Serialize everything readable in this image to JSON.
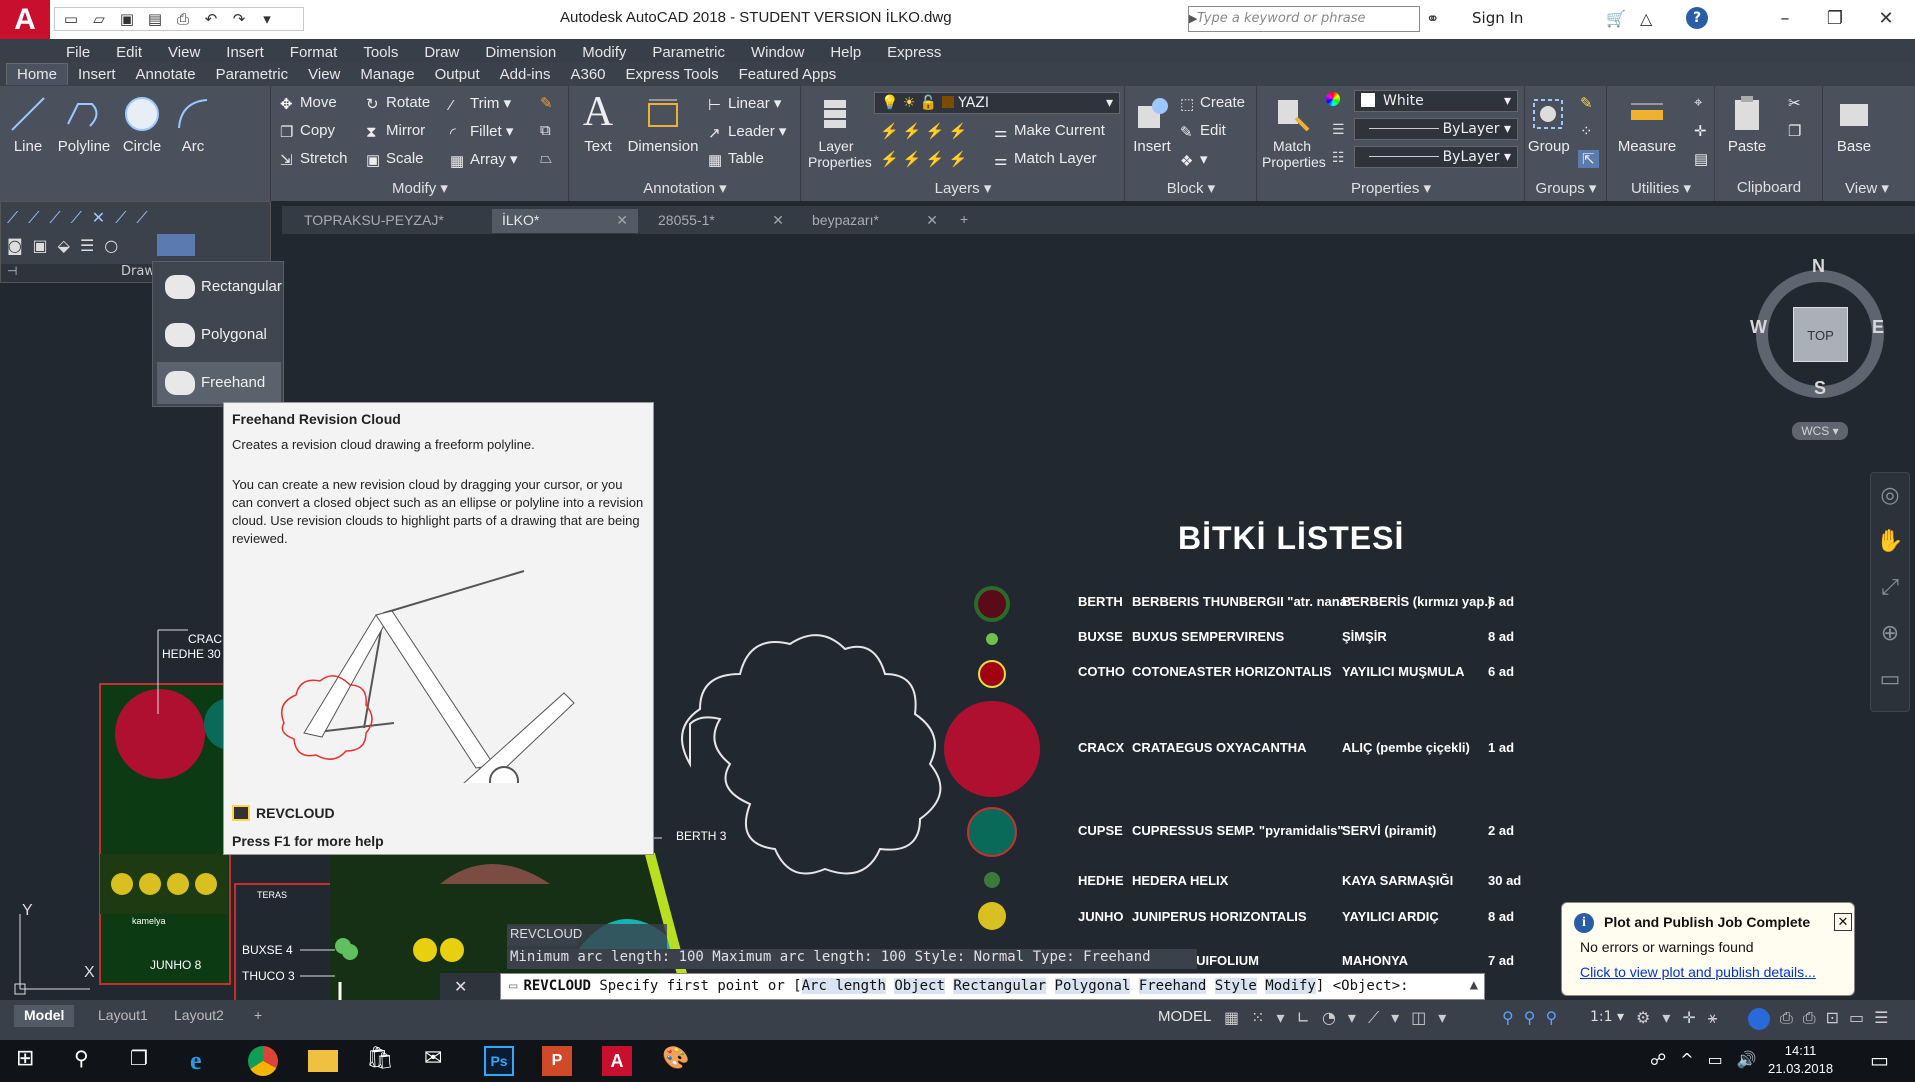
{
  "window": {
    "title": "Autodesk AutoCAD 2018 - STUDENT VERSION    İLKO.dwg",
    "search_placeholder": "Type a keyword or phrase",
    "signin": "Sign In"
  },
  "menubar": [
    "File",
    "Edit",
    "View",
    "Insert",
    "Format",
    "Tools",
    "Draw",
    "Dimension",
    "Modify",
    "Parametric",
    "Window",
    "Help",
    "Express"
  ],
  "ribbon_tabs": [
    "Home",
    "Insert",
    "Annotate",
    "Parametric",
    "View",
    "Manage",
    "Output",
    "Add-ins",
    "A360",
    "Express Tools",
    "Featured Apps"
  ],
  "ribbon": {
    "draw": {
      "line": "Line",
      "polyline": "Polyline",
      "circle": "Circle",
      "arc": "Arc"
    },
    "modify": {
      "label": "Modify",
      "move": "Move",
      "rotate": "Rotate",
      "trim": "Trim",
      "copy": "Copy",
      "mirror": "Mirror",
      "fillet": "Fillet",
      "stretch": "Stretch",
      "scale": "Scale",
      "array": "Array"
    },
    "annotation": {
      "label": "Annotation",
      "text": "Text",
      "dimension": "Dimension",
      "linear": "Linear",
      "leader": "Leader",
      "table": "Table"
    },
    "layers": {
      "label": "Layers",
      "layer_properties": "Layer Properties",
      "current_layer": "YAZI",
      "make_current": "Make Current",
      "match_layer": "Match Layer"
    },
    "block": {
      "label": "Block",
      "insert": "Insert",
      "create": "Create",
      "edit": "Edit"
    },
    "properties": {
      "label": "Properties",
      "match": "Match Properties",
      "color": "White",
      "linetype": "ByLayer",
      "lineweight": "ByLayer"
    },
    "groups": {
      "label": "Groups",
      "group": "Group"
    },
    "utilities": {
      "label": "Utilities",
      "measure": "Measure"
    },
    "clipboard": {
      "label": "Clipboard",
      "paste": "Paste"
    },
    "view": {
      "label": "View",
      "base": "Base"
    }
  },
  "draw_toolbar": {
    "label": "Draw"
  },
  "file_tabs": [
    "TOPRAKSU-PEYZAJ*",
    "İLKO*",
    "28055-1*",
    "beypazarı*"
  ],
  "revcloud_menu": [
    "Rectangular",
    "Polygonal",
    "Freehand"
  ],
  "tooltip": {
    "title": "Freehand Revision Cloud",
    "desc1": "Creates a revision cloud drawing a freeform polyline.",
    "desc2": "You can create a new revision cloud by dragging your cursor, or you can convert a closed object such as an ellipse or polyline into a revision cloud. Use revision clouds to highlight parts of a drawing that are being reviewed.",
    "command": "REVCLOUD",
    "help": "Press F1 for more help"
  },
  "plant_list": {
    "title": "BİTKİ LİSTESİ",
    "rows": [
      {
        "code": "BERTH",
        "latin": "BERBERIS THUNBERGII \"atr. nana\"",
        "local": "BERBERİS (kırmızı yap.)",
        "qty": "6 ad"
      },
      {
        "code": "BUXSE",
        "latin": "BUXUS SEMPERVIRENS",
        "local": "ŞİMŞİR",
        "qty": "8 ad"
      },
      {
        "code": "COTHO",
        "latin": "COTONEASTER HORIZONTALIS",
        "local": "YAYILICI MUŞMULA",
        "qty": "6 ad"
      },
      {
        "code": "CRACX",
        "latin": "CRATAEGUS OXYACANTHA",
        "local": "ALIÇ (pembe çiçekli)",
        "qty": "1 ad"
      },
      {
        "code": "CUPSE",
        "latin": "CUPRESSUS SEMP. \"pyramidalis\"",
        "local": "SERVİ (piramit)",
        "qty": "2 ad"
      },
      {
        "code": "HEDHE",
        "latin": "HEDERA HELIX",
        "local": "KAYA SARMAŞIĞI",
        "qty": "30 ad"
      },
      {
        "code": "JUNHO",
        "latin": "JUNIPERUS HORIZONTALIS",
        "local": "YAYILICI ARDIÇ",
        "qty": "8 ad"
      },
      {
        "code": "",
        "latin": "QUIFOLIUM",
        "local": "MAHONYA",
        "qty": "7 ad"
      }
    ]
  },
  "drawing_labels": {
    "crac": "CRAC",
    "hedhe30": "HEDHE 30",
    "berth3": "BERTH 3",
    "buxse4": "BUXSE 4",
    "thuco3": "THUCO 3",
    "junho8": "JUNHO 8",
    "teras": "TERAS",
    "kamelya": "kamelya"
  },
  "viewcube": {
    "n": "N",
    "s": "S",
    "e": "E",
    "w": "W",
    "top": "TOP",
    "wcs": "WCS"
  },
  "command": {
    "label": "REVCLOUD",
    "history": "Minimum arc length: 100   Maximum arc length: 100   Style: Normal   Type: Freehand",
    "cmd": "REVCLOUD",
    "prompt": "Specify first point or [",
    "options": [
      "Arc length",
      "Object",
      "Rectangular",
      "Polygonal",
      "Freehand",
      "Style",
      "Modify"
    ],
    "default": "] <Object>:"
  },
  "layout_tabs": [
    "Model",
    "Layout1",
    "Layout2"
  ],
  "status": {
    "model": "MODEL",
    "scale": "1:1"
  },
  "notification": {
    "title": "Plot and Publish Job Complete",
    "body": "No errors or warnings found",
    "link": "Click to view plot and publish details..."
  },
  "clock": {
    "time": "14:11",
    "date": "21.03.2018"
  }
}
